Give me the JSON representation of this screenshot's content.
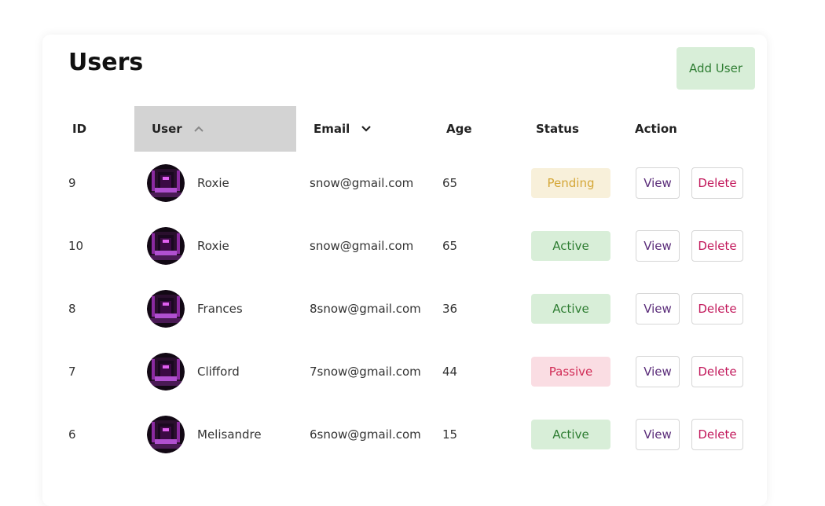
{
  "page": {
    "title": "Users",
    "add_user_label": "Add User"
  },
  "table": {
    "columns": [
      {
        "label": "ID",
        "sort": "none"
      },
      {
        "label": "User",
        "sort": "asc"
      },
      {
        "label": "Email",
        "sort": "desc"
      },
      {
        "label": "Age",
        "sort": "none"
      },
      {
        "label": "Status",
        "sort": "none"
      },
      {
        "label": "Action",
        "sort": "none"
      }
    ],
    "rows": [
      {
        "id": "9",
        "name": "Roxie",
        "email": "snow@gmail.com",
        "age": "65",
        "status": "Pending",
        "view_label": "View",
        "delete_label": "Delete"
      },
      {
        "id": "10",
        "name": "Roxie",
        "email": "snow@gmail.com",
        "age": "65",
        "status": "Active",
        "view_label": "View",
        "delete_label": "Delete"
      },
      {
        "id": "8",
        "name": "Frances",
        "email": "8snow@gmail.com",
        "age": "36",
        "status": "Active",
        "view_label": "View",
        "delete_label": "Delete"
      },
      {
        "id": "7",
        "name": "Clifford",
        "email": "7snow@gmail.com",
        "age": "44",
        "status": "Passive",
        "view_label": "View",
        "delete_label": "Delete"
      },
      {
        "id": "6",
        "name": "Melisandre",
        "email": "6snow@gmail.com",
        "age": "15",
        "status": "Active",
        "view_label": "View",
        "delete_label": "Delete"
      }
    ]
  },
  "colors": {
    "pending_bg": "#f8f0da",
    "pending_text": "#d4a636",
    "active_bg": "#d8eed8",
    "active_text": "#2e7d32",
    "passive_bg": "#fadde3",
    "passive_text": "#d12d57",
    "sorted_header_bg": "#d3d3d3"
  }
}
